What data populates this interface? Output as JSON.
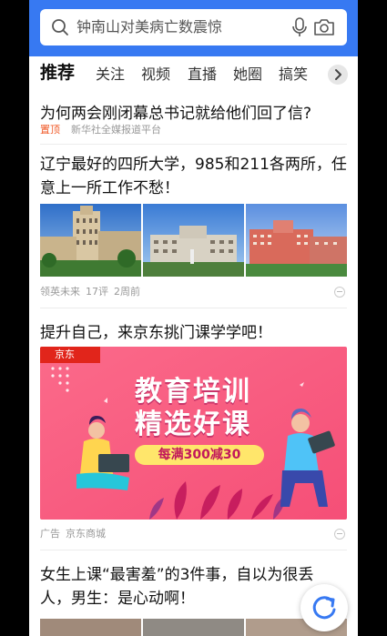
{
  "search": {
    "text": "钟南山对美病亡数震惊",
    "icon": "search-icon",
    "mic_icon": "microphone-icon",
    "camera_icon": "camera-icon"
  },
  "tabs": [
    {
      "label": "推荐",
      "active": true
    },
    {
      "label": "关注"
    },
    {
      "label": "视频"
    },
    {
      "label": "直播"
    },
    {
      "label": "她圈"
    },
    {
      "label": "搞笑"
    }
  ],
  "feed": [
    {
      "title": "为何两会刚闭幕总书记就给他们回了信?",
      "pin": "置顶",
      "source": "新华社全媒报道平台"
    },
    {
      "title": "辽宁最好的四所大学，985和211各两所，任意上一所工作不愁！",
      "source": "领英未来",
      "comments": "17评",
      "time": "2周前"
    },
    {
      "title": "提升自己，来京东挑门课学学吧！",
      "ad_logo": "京东",
      "ad_title_1": "教育培训",
      "ad_title_2": "精选好课",
      "ad_promo": "每满300减30",
      "ad_label": "广告",
      "source": "京东商城"
    },
    {
      "title": "女生上课“最害羞”的3件事，自以为很丢人，男生：是心动啊！"
    }
  ],
  "colors": {
    "brand_blue": "#3779f2",
    "pin_orange": "#f05a28",
    "ad_pink": "#fb5f80"
  }
}
